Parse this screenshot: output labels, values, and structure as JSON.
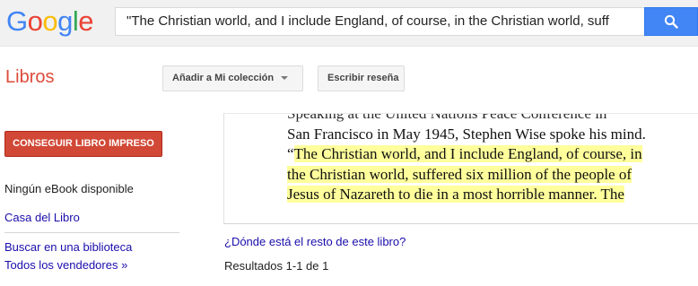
{
  "header": {
    "logo_letters": [
      {
        "ch": "G",
        "color": "#4285f4"
      },
      {
        "ch": "o",
        "color": "#ea4335"
      },
      {
        "ch": "o",
        "color": "#fbbc05"
      },
      {
        "ch": "g",
        "color": "#4285f4"
      },
      {
        "ch": "l",
        "color": "#34a853"
      },
      {
        "ch": "e",
        "color": "#ea4335"
      }
    ],
    "search_query": "\"The Christian world, and I include England, of course, in the Christian world, suff",
    "search_icon": "search-icon"
  },
  "nav": {
    "section_title": "Libros",
    "add_collection_label": "Añadir a Mi colección",
    "write_review_label": "Escribir reseña"
  },
  "sidebar": {
    "buy_button_label": "CONSEGUIR LIBRO IMPRESO",
    "no_ebook": "Ningún eBook disponible",
    "store_link": "Casa del Libro",
    "library_link": "Buscar en una biblioteca",
    "all_sellers_link": "Todos los vendedores »"
  },
  "snippet": {
    "line1": "Speaking at the United Nations Peace Conference in",
    "line2": "San Francisco in May 1945, Stephen Wise spoke his mind.",
    "line3_prefix": "“",
    "line3_hl": "The Christian world, and I include England, of course, in",
    "line4_hl": "the Christian world, suffered six million of the people of",
    "line5_hl": "Jesus of Nazareth to die in a most horrible manner. The"
  },
  "content": {
    "where_link": "¿Dónde está el resto de este libro?",
    "results_text": "Resultados 1-1 de 1"
  },
  "colors": {
    "accent_red": "#dd4b39",
    "button_red": "#d14836",
    "search_blue": "#4285f4",
    "link_blue": "#1a0dab",
    "highlight": "#ffff9c"
  }
}
